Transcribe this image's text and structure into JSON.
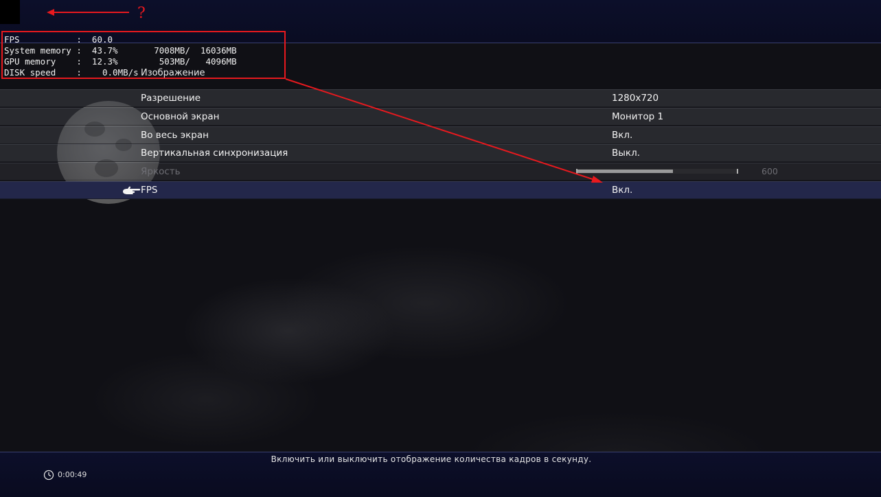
{
  "annotation": {
    "question_mark": "?"
  },
  "stats_overlay": {
    "lines": [
      "FPS           :  60.0",
      "System memory :  43.7%       7008MB/  16036MB",
      "GPU memory    :  12.3%        503MB/   4096MB",
      "DISK speed    :    0.0MB/s"
    ]
  },
  "section": {
    "title": "Изображение"
  },
  "settings": {
    "resolution": {
      "label": "Разрешение",
      "value": "1280x720"
    },
    "main_screen": {
      "label": "Основной экран",
      "value": "Монитор 1"
    },
    "fullscreen": {
      "label": "Во весь экран",
      "value": "Вкл."
    },
    "vsync": {
      "label": "Вертикальная синхронизация",
      "value": "Выкл."
    },
    "brightness": {
      "label": "Яркость",
      "value_text": "600",
      "level_fraction": 0.6
    },
    "fps": {
      "label": "FPS",
      "value": "Вкл."
    }
  },
  "footer": {
    "help": "Включить или выключить отображение количества кадров в секунду.",
    "timer": "0:00:49"
  },
  "colors": {
    "annotation_red": "#e8191e",
    "selected_row": "#23274a",
    "bar_navy": "#0c0f2a"
  }
}
